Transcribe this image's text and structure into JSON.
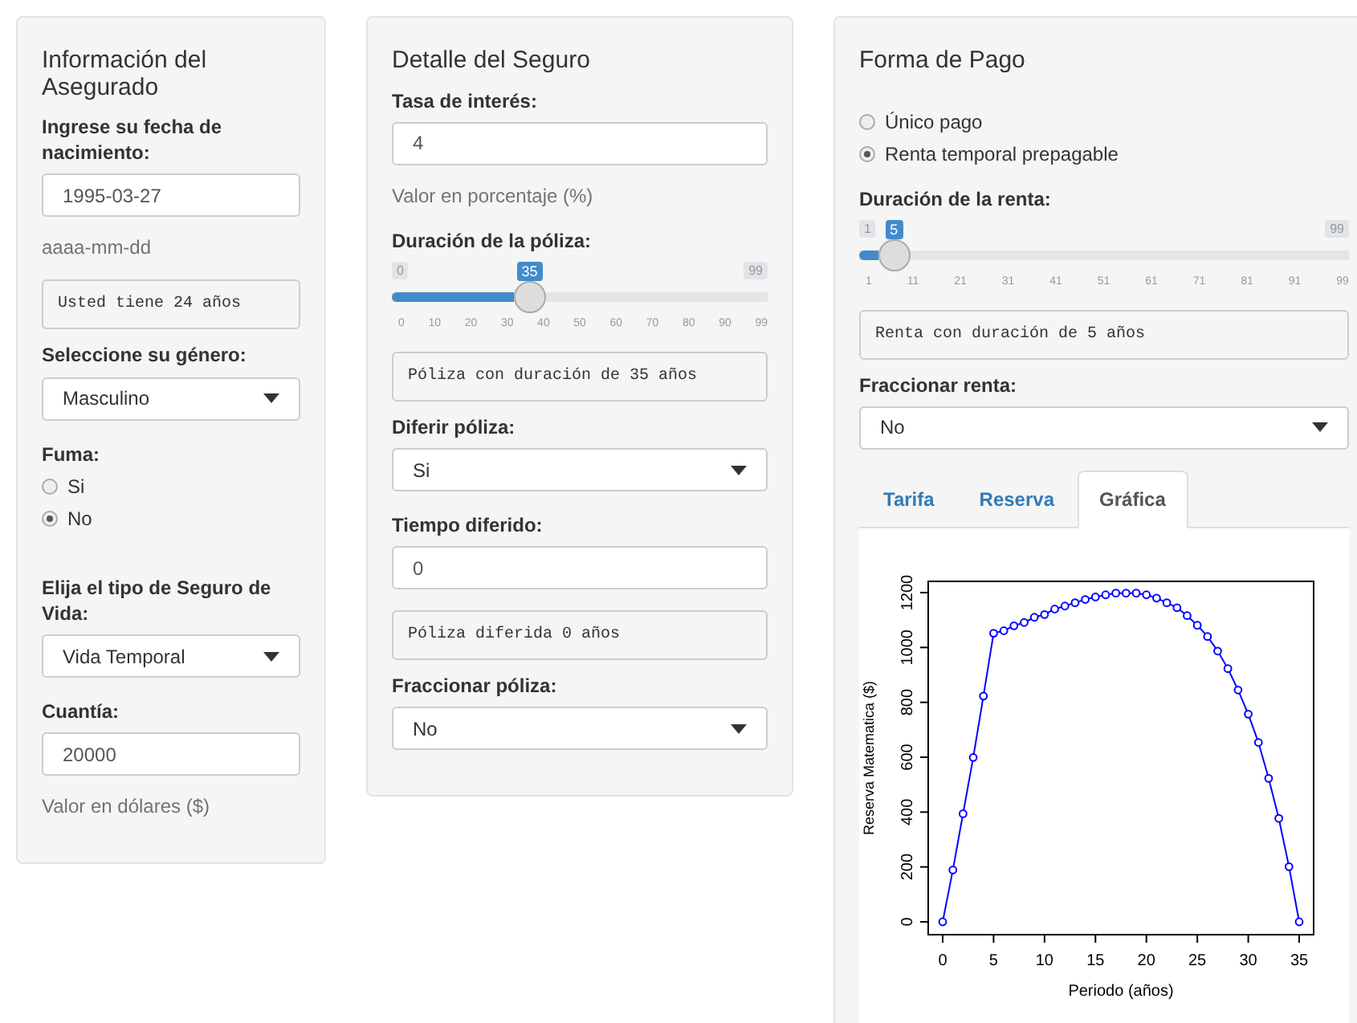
{
  "panels": [
    {
      "title": "Información del Asegurado",
      "fields": [
        {
          "kind": "date",
          "label": "Ingrese su fecha de nacimiento:",
          "value": "1995-03-27",
          "help": "aaaa-mm-dd"
        },
        {
          "kind": "output",
          "text": "Usted tiene 24 años"
        },
        {
          "kind": "select",
          "label": "Seleccione su género:",
          "value": "Masculino"
        },
        {
          "kind": "radio",
          "label": "Fuma:",
          "options": [
            {
              "label": "Si",
              "selected": false
            },
            {
              "label": "No",
              "selected": true
            }
          ]
        },
        {
          "kind": "select",
          "label": "Elija el tipo de Seguro de Vida:",
          "value": "Vida Temporal"
        },
        {
          "kind": "number",
          "label": "Cuantía:",
          "value": "20000",
          "help": "Valor en dólares ($)"
        }
      ]
    },
    {
      "title": "Detalle del Seguro",
      "fields": [
        {
          "kind": "number",
          "label": "Tasa de interés:",
          "value": "4",
          "help": "Valor en porcentaje (%)"
        },
        {
          "kind": "slider",
          "label": "Duración de la póliza:",
          "min": "0",
          "max": "99",
          "value": "35",
          "level": 0.354,
          "ticks": [
            "0",
            "10",
            "20",
            "30",
            "40",
            "50",
            "60",
            "70",
            "80",
            "90",
            "99"
          ]
        },
        {
          "kind": "output",
          "text": "Póliza con duración de 35 años"
        },
        {
          "kind": "select",
          "label": "Diferir póliza:",
          "value": "Si"
        },
        {
          "kind": "number",
          "label": "Tiempo diferido:",
          "value": "0"
        },
        {
          "kind": "output",
          "text": "Póliza diferida 0 años"
        },
        {
          "kind": "select",
          "label": "Fraccionar póliza:",
          "value": "No"
        }
      ]
    },
    {
      "title": "Forma de Pago",
      "fields": [
        {
          "kind": "radio",
          "options": [
            {
              "label": "Único pago",
              "selected": false
            },
            {
              "label": "Renta temporal prepagable",
              "selected": true
            }
          ]
        },
        {
          "kind": "slider",
          "label": "Duración de la renta:",
          "min": "1",
          "max": "99",
          "value": "5",
          "level": 0.041,
          "ticks": [
            "1",
            "11",
            "21",
            "31",
            "41",
            "51",
            "61",
            "71",
            "81",
            "91",
            "99"
          ]
        },
        {
          "kind": "output",
          "text": "Renta con duración de 5 años"
        },
        {
          "kind": "select",
          "label": "Fraccionar renta:",
          "value": "No"
        },
        {
          "kind": "tabs",
          "tabs": [
            {
              "label": "Tarifa",
              "selected": false
            },
            {
              "label": "Reserva",
              "selected": false
            },
            {
              "label": "Gráfica",
              "selected": true
            }
          ],
          "chart_data": {
            "type": "line",
            "xlabel": "Periodo (años)",
            "ylabel": "Reserva Matematica ($)",
            "x": [
              0,
              1,
              2,
              3,
              4,
              5,
              6,
              7,
              8,
              9,
              10,
              11,
              12,
              13,
              14,
              15,
              16,
              17,
              18,
              19,
              20,
              21,
              22,
              23,
              24,
              25,
              26,
              27,
              28,
              29,
              30,
              31,
              32,
              33,
              34,
              35
            ],
            "series": [
              {
                "color": "#0000ff",
                "marker": "circle",
                "values": [
                  0,
                  189,
                  394,
                  599,
                  823,
                  1052,
                  1061,
                  1079,
                  1091,
                  1110,
                  1120,
                  1140,
                  1151,
                  1163,
                  1175,
                  1184,
                  1192,
                  1198,
                  1198,
                  1198,
                  1192,
                  1180,
                  1163,
                  1145,
                  1116,
                  1081,
                  1040,
                  987,
                  923,
                  845,
                  757,
                  654,
                  523,
                  377,
                  201,
                  0
                ]
              }
            ],
            "xlim": [
              0,
              35
            ],
            "ylim": [
              0,
              1200
            ],
            "xticks": [
              0,
              5,
              10,
              15,
              20,
              25,
              30,
              35
            ],
            "yticks": [
              0,
              200,
              400,
              600,
              800,
              1000,
              1200
            ]
          }
        }
      ]
    }
  ]
}
